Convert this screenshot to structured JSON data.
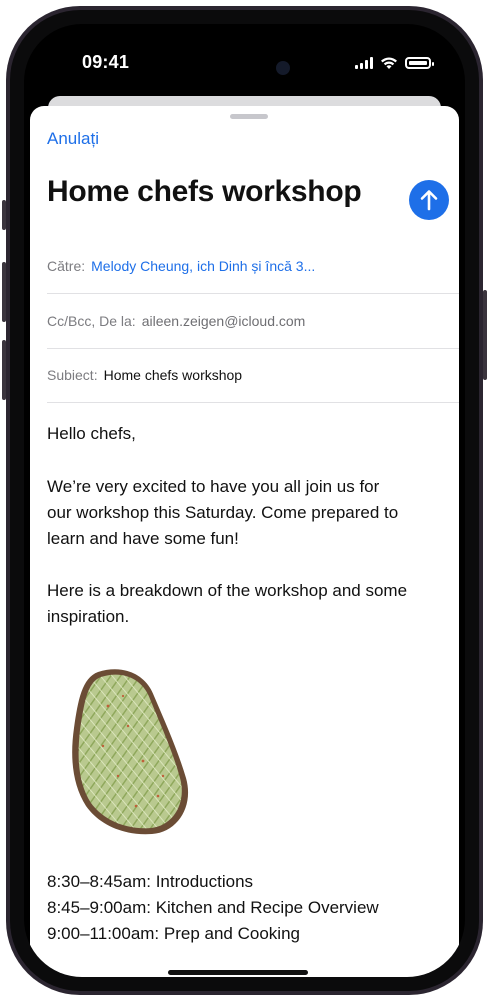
{
  "status_bar": {
    "time": "09:41"
  },
  "compose": {
    "cancel_label": "Anulați",
    "title": "Home chefs workshop",
    "send_icon": "arrow-up-icon",
    "to": {
      "label": "Către:",
      "value": "Melody Cheung, ich Dinh și încă 3..."
    },
    "cc_from": {
      "label": "Cc/Bcc, De la:",
      "value": "aileen.zeigen@icloud.com"
    },
    "subject": {
      "label": "Subiect:",
      "value": "Home chefs workshop"
    }
  },
  "body": {
    "greeting": "Hello chefs,",
    "paragraph1_line1": "We’re very excited to have you all join us for",
    "paragraph1_line2": "our workshop this Saturday. Come prepared to",
    "paragraph1_line3": "learn and have some fun!",
    "paragraph2_line1": "Here is a breakdown of the workshop and some",
    "paragraph2_line2": "inspiration.",
    "schedule": [
      "8:30–8:45am: Introductions",
      "8:45–9:00am: Kitchen and Recipe Overview",
      "9:00–11:00am: Prep and Cooking"
    ]
  },
  "colors": {
    "accent": "#1e6fe8",
    "frame": "#2b2530"
  }
}
